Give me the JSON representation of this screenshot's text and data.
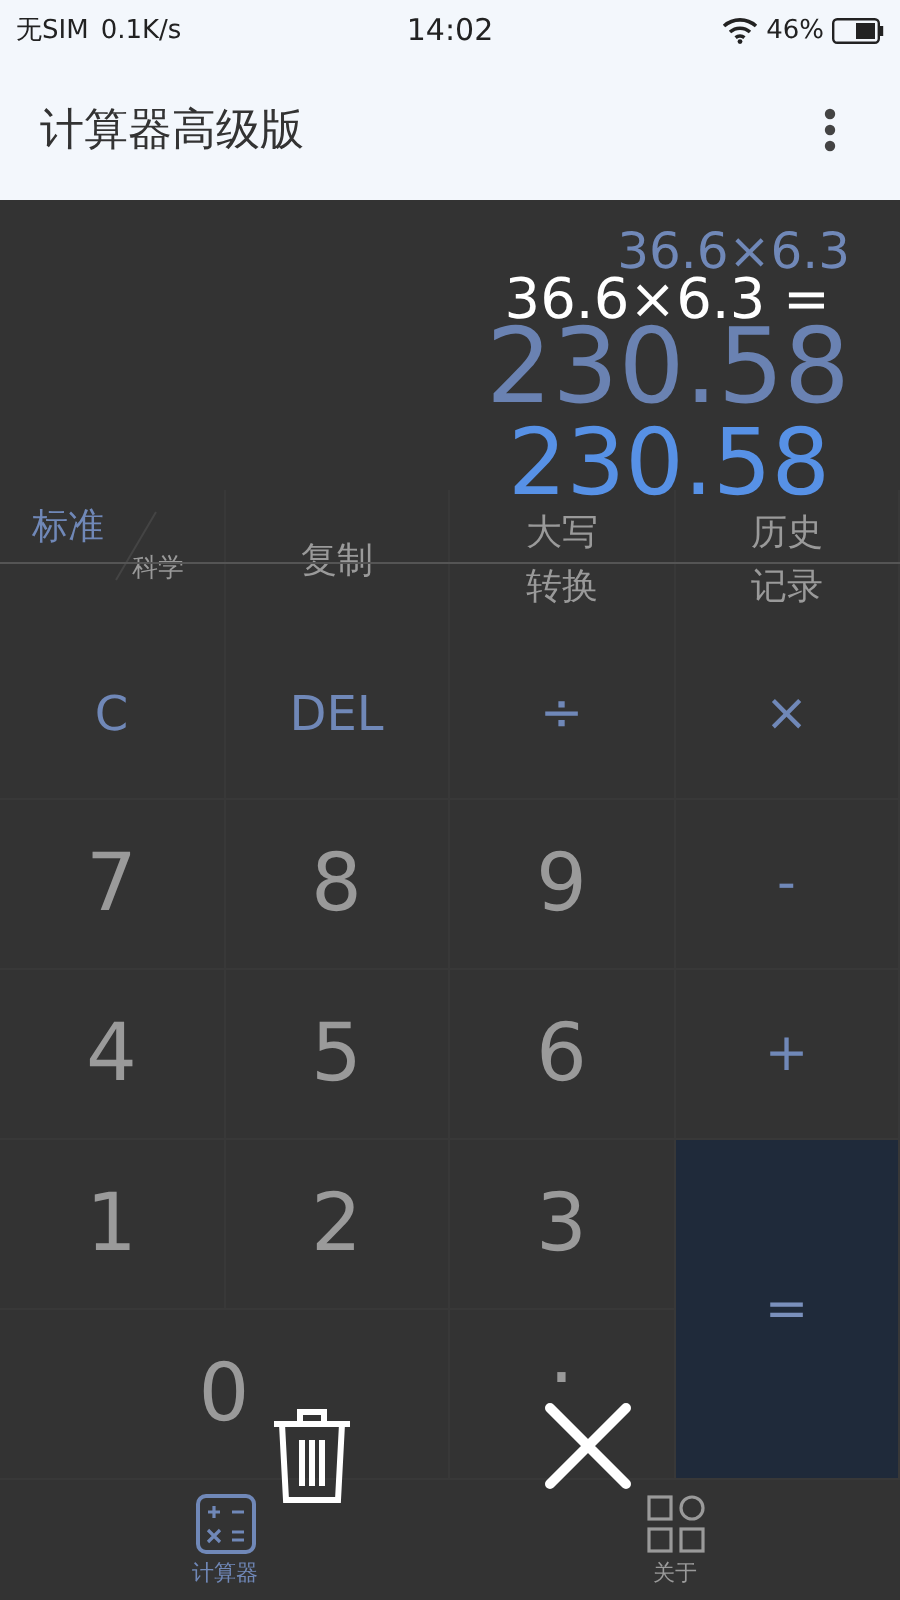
{
  "status_bar": {
    "carrier": "无SIM",
    "speed": "0.1K/s",
    "time": "14:02",
    "battery": "46%"
  },
  "app_bar": {
    "title": "计算器高级版"
  },
  "display": {
    "expression": "36.6×6.3",
    "result": "230.58"
  },
  "toolbar": [
    {
      "kind": "mode",
      "lines": [
        "标准",
        "科学"
      ]
    },
    {
      "kind": "plain",
      "lines": [
        "复制"
      ]
    },
    {
      "kind": "plain",
      "lines": [
        "大写",
        "转换"
      ]
    },
    {
      "kind": "plain",
      "lines": [
        "历史",
        "记录"
      ]
    }
  ],
  "keys": [
    {
      "kind": "func",
      "label": "C"
    },
    {
      "kind": "func",
      "label": "DEL"
    },
    {
      "kind": "op",
      "label": "÷"
    },
    {
      "kind": "op",
      "label": "×"
    },
    {
      "kind": "digit",
      "label": "7"
    },
    {
      "kind": "digit",
      "label": "8"
    },
    {
      "kind": "digit",
      "label": "9"
    },
    {
      "kind": "op",
      "label": "-"
    },
    {
      "kind": "digit",
      "label": "4"
    },
    {
      "kind": "digit",
      "label": "5"
    },
    {
      "kind": "digit",
      "label": "6"
    },
    {
      "kind": "op",
      "label": "+"
    },
    {
      "kind": "digit",
      "label": "1"
    },
    {
      "kind": "digit",
      "label": "2"
    },
    {
      "kind": "digit",
      "label": "3"
    },
    {
      "kind": "equals",
      "label": "="
    },
    {
      "kind": "zero",
      "label": "0"
    },
    {
      "kind": "digit",
      "label": "."
    }
  ],
  "overlay": {
    "expression": "36.6×6.3 =",
    "result": "230.58"
  },
  "bottom_nav": [
    {
      "kind": "calculator",
      "label": "计算器",
      "selected": true
    },
    {
      "kind": "about",
      "label": "关于",
      "selected": false
    }
  ]
}
